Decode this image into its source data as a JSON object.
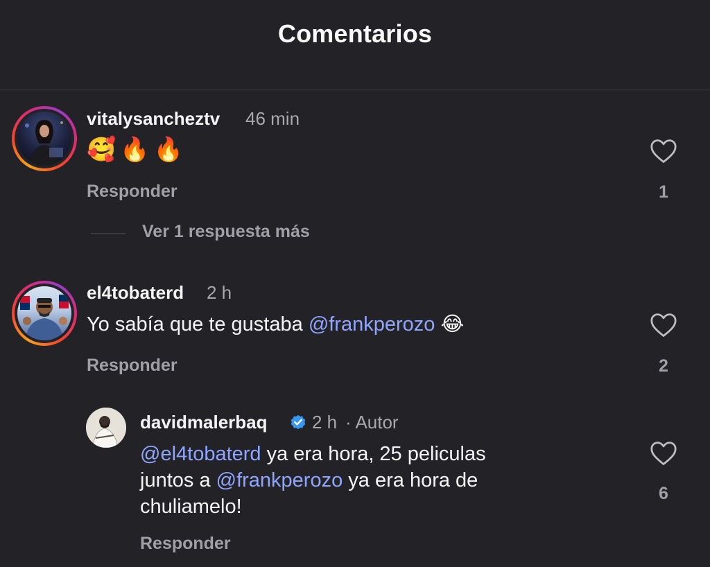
{
  "header": {
    "title": "Comentarios"
  },
  "comments": [
    {
      "username": "vitalysancheztv",
      "time": "46 min",
      "text": "🥰🔥🔥",
      "reply_label": "Responder",
      "likes": "1",
      "view_more": "Ver 1 respuesta más"
    },
    {
      "username": "el4tobaterd",
      "time": "2 h",
      "text_before": "Yo sabía que te gustaba ",
      "mention": "@frankperozo",
      "text_after": " 😂",
      "reply_label": "Responder",
      "likes": "2"
    }
  ],
  "reply": {
    "username": "davidmalerbaq",
    "time": "2 h",
    "author_tag": "· Autor",
    "mention1": "@el4tobaterd",
    "text1": " ya era hora, 25 peliculas",
    "text2": "juntos a ",
    "mention2": "@frankperozo",
    "text3": " ya era hora de",
    "text4": "chuliamelo!",
    "reply_label": "Responder",
    "likes": "6"
  },
  "colors": {
    "background": "#232327",
    "mention": "#8ea6ff",
    "verified": "#3897f0"
  }
}
